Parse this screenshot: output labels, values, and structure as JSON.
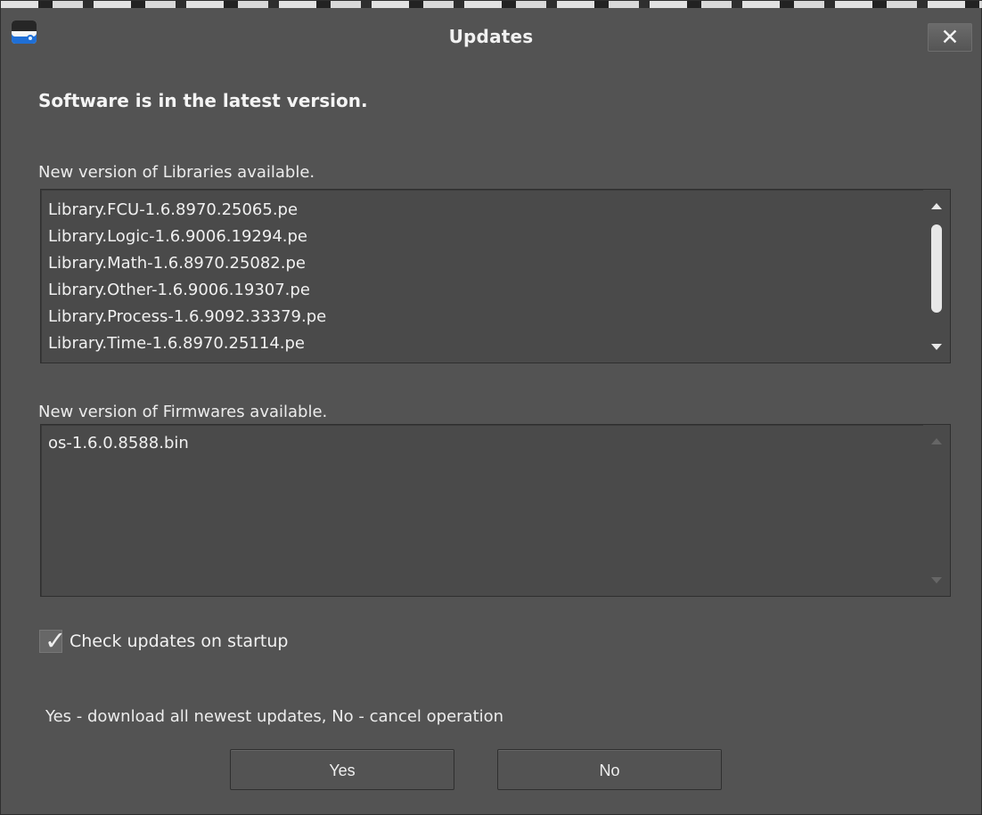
{
  "window": {
    "title": "Updates",
    "close_label": "✕"
  },
  "status": {
    "message": "Software is in the latest version."
  },
  "libraries": {
    "label": "New version of Libraries available.",
    "items": [
      "Library.FCU-1.6.8970.25065.pe",
      "Library.Logic-1.6.9006.19294.pe",
      "Library.Math-1.6.8970.25082.pe",
      "Library.Other-1.6.9006.19307.pe",
      "Library.Process-1.6.9092.33379.pe",
      "Library.Time-1.6.8970.25114.pe"
    ]
  },
  "firmwares": {
    "label": "New version of Firmwares available.",
    "items": [
      "os-1.6.0.8588.bin"
    ]
  },
  "options": {
    "check_updates_label": "Check updates on startup",
    "check_updates_checked": true
  },
  "footer": {
    "hint": "Yes - download all newest updates, No - cancel operation",
    "yes_label": "Yes",
    "no_label": "No"
  },
  "icons": {
    "app": "app-icon",
    "close": "close-icon",
    "checkmark": "checkmark-icon",
    "scroll_up": "scroll-up-icon",
    "scroll_down": "scroll-down-icon"
  },
  "colors": {
    "window_background": "#535353",
    "list_background": "#4a4a4a",
    "text": "#f0f0f0",
    "accent_blue": "#1f6fd6"
  }
}
